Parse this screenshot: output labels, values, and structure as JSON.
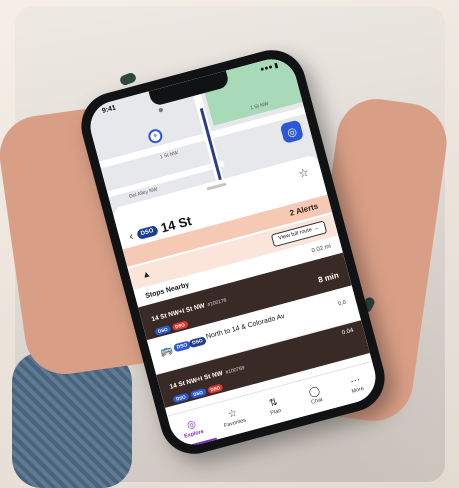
{
  "status_bar": {
    "time": "9:41",
    "indicators": "●●● ▮"
  },
  "map": {
    "street_1": "1 St NW",
    "street_2": "1 St NW",
    "street_3": "Del Alley NW",
    "location_icon": "crosshair-icon",
    "recenter_icon": "recenter-icon"
  },
  "stop": {
    "route_badge": "DSO",
    "title": "14 St",
    "alerts_label": "2 Alerts",
    "view_full_route": "View full route →"
  },
  "stops_nearby": {
    "heading": "Stops Nearby",
    "distance": "0.02 mi",
    "stops": [
      {
        "name": "14 St NW+I St NW",
        "stop_id": "#100176",
        "chips": [
          "DSO",
          "DSO"
        ],
        "arrival": "8 min"
      },
      {
        "name": "14 St NW+I St NW",
        "stop_id": "#100769",
        "chips": [
          "DSO",
          "DSO",
          "DSO"
        ],
        "distance": "0.04"
      }
    ],
    "trip": {
      "badge_1": "DSO",
      "badge_2": "DSO",
      "text": "North to 14 & Colorado Av",
      "distance": "0.0"
    }
  },
  "tabs": [
    {
      "label": "Explore",
      "icon": "compass-icon",
      "active": true
    },
    {
      "label": "Favorites",
      "icon": "star-icon",
      "active": false
    },
    {
      "label": "Plan",
      "icon": "route-icon",
      "active": false
    },
    {
      "label": "Chat",
      "icon": "chat-icon",
      "active": false
    },
    {
      "label": "More",
      "icon": "more-icon",
      "active": false
    }
  ],
  "colors": {
    "accent_purple": "#7a2bd0",
    "brand_blue": "#2a58d6",
    "alert_bg": "#f6c9b4",
    "card_dark": "#3a2a25"
  }
}
